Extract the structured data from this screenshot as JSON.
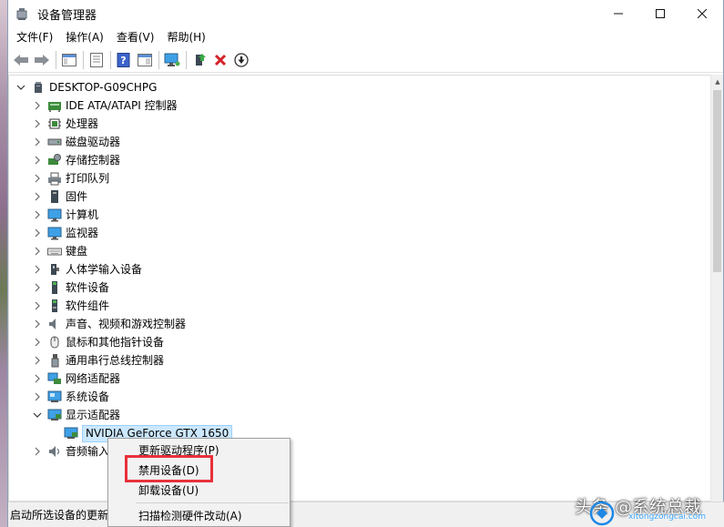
{
  "window": {
    "title": "设备管理器",
    "controls": {
      "minimize": "—",
      "maximize": "☐",
      "close": "✕"
    }
  },
  "menubar": {
    "items": [
      "文件(F)",
      "操作(A)",
      "查看(V)",
      "帮助(H)"
    ]
  },
  "toolbar": {
    "buttons": [
      "back-icon",
      "forward-icon",
      "show-hide-console-tree-icon",
      "properties-icon",
      "help-icon",
      "action-pane-icon",
      "monitor-icon",
      "update-driver-icon",
      "uninstall-icon",
      "disable-icon"
    ]
  },
  "tree": {
    "root": "DESKTOP-G09CHPG",
    "categories": [
      {
        "label": "IDE ATA/ATAPI 控制器",
        "icon": "ide-controller-icon",
        "expanded": false
      },
      {
        "label": "处理器",
        "icon": "processor-icon",
        "expanded": false
      },
      {
        "label": "磁盘驱动器",
        "icon": "disk-drive-icon",
        "expanded": false
      },
      {
        "label": "存储控制器",
        "icon": "storage-controller-icon",
        "expanded": false
      },
      {
        "label": "打印队列",
        "icon": "printer-icon",
        "expanded": false
      },
      {
        "label": "固件",
        "icon": "firmware-icon",
        "expanded": false
      },
      {
        "label": "计算机",
        "icon": "computer-icon",
        "expanded": false
      },
      {
        "label": "监视器",
        "icon": "monitor-icon",
        "expanded": false
      },
      {
        "label": "键盘",
        "icon": "keyboard-icon",
        "expanded": false
      },
      {
        "label": "人体学输入设备",
        "icon": "hid-icon",
        "expanded": false
      },
      {
        "label": "软件设备",
        "icon": "software-device-icon",
        "expanded": false
      },
      {
        "label": "软件组件",
        "icon": "software-component-icon",
        "expanded": false
      },
      {
        "label": "声音、视频和游戏控制器",
        "icon": "sound-icon",
        "expanded": false
      },
      {
        "label": "鼠标和其他指针设备",
        "icon": "mouse-icon",
        "expanded": false
      },
      {
        "label": "通用串行总线控制器",
        "icon": "usb-icon",
        "expanded": false
      },
      {
        "label": "网络适配器",
        "icon": "network-adapter-icon",
        "expanded": false
      },
      {
        "label": "系统设备",
        "icon": "system-device-icon",
        "expanded": false
      },
      {
        "label": "显示适配器",
        "icon": "display-adapter-icon",
        "expanded": true
      },
      {
        "label": "NVIDIA GeForce GTX 1650",
        "icon": "display-adapter-icon",
        "child": true,
        "selected": true
      },
      {
        "label": "音频输入",
        "icon": "audio-io-icon",
        "expanded": false
      }
    ]
  },
  "context_menu": {
    "items": [
      "更新驱动程序(P)",
      "禁用设备(D)",
      "卸载设备(U)",
      "扫描检测硬件改动(A)"
    ]
  },
  "statusbar": {
    "text": "启动所选设备的更新"
  },
  "watermark": {
    "text": "头条 @系统总裁",
    "url": "xitongzongcai.com"
  }
}
